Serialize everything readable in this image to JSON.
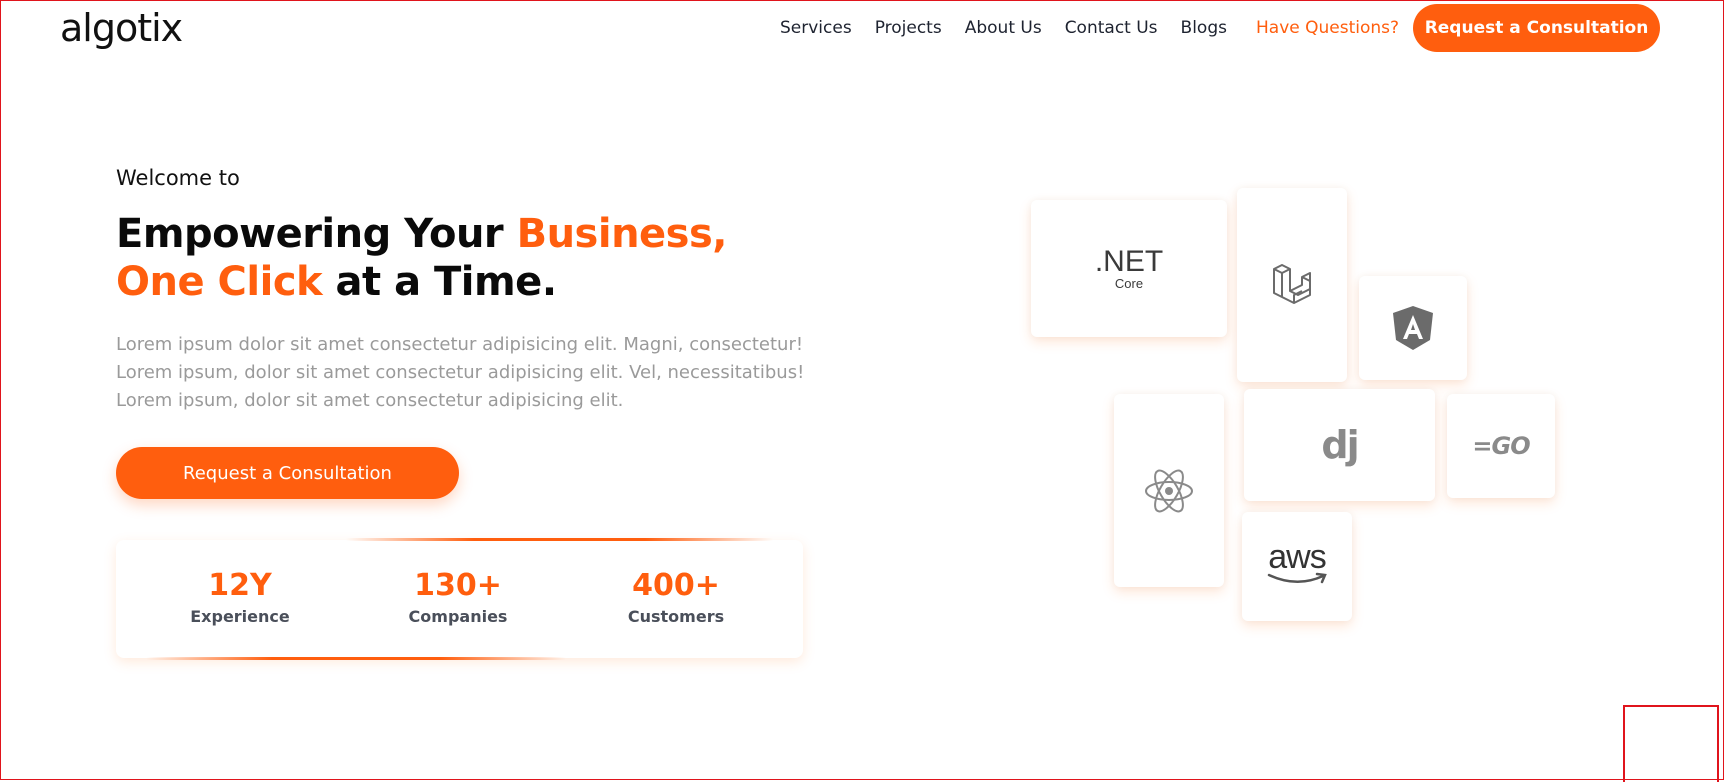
{
  "header": {
    "logo": "algotix",
    "nav": [
      "Services",
      "Projects",
      "About Us",
      "Contact Us",
      "Blogs"
    ],
    "questions_link": "Have Questions?",
    "cta": "Request a Consultation"
  },
  "hero": {
    "welcome": "Welcome to",
    "headline": {
      "line1_a": "Empowering Your ",
      "line1_b": "Business,",
      "line2_a": "One Click",
      "line2_b": " at a Time."
    },
    "description": [
      "Lorem ipsum dolor sit amet consectetur adipisicing elit. Magni, consectetur!",
      "Lorem ipsum, dolor sit amet consectetur adipisicing elit. Vel, necessitatibus!",
      "Lorem ipsum, dolor sit amet consectetur adipisicing elit."
    ],
    "cta": "Request a Consultation"
  },
  "stats": [
    {
      "value": "12Y",
      "label": "Experience"
    },
    {
      "value": "130+",
      "label": "Companies"
    },
    {
      "value": "400+",
      "label": "Customers"
    }
  ],
  "tech": {
    "dotnet": {
      "name": ".NET",
      "sub": "Core"
    },
    "django": "dj",
    "go": "=GO",
    "aws": "aws",
    "icons": [
      "dotnet-icon",
      "laravel-icon",
      "angular-icon",
      "react-icon",
      "django-icon",
      "go-icon",
      "aws-icon"
    ]
  },
  "colors": {
    "accent": "#ff5e0e",
    "text": "#0a0a0a",
    "muted": "#9a9a9a"
  }
}
